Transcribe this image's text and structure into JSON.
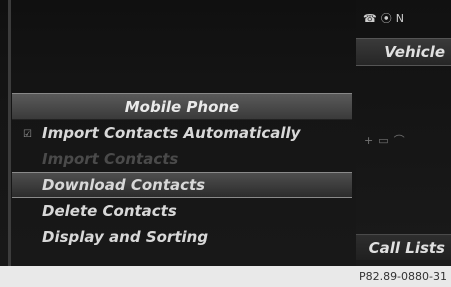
{
  "status_bar": {
    "signal_label": "N"
  },
  "right_panel": {
    "vehicle_label": "Vehicle",
    "call_lists_label": "Call Lists"
  },
  "menu": {
    "title": "Mobile Phone",
    "items": [
      {
        "label": "Import Contacts Automatically",
        "state": "checked"
      },
      {
        "label": "Import Contacts",
        "state": "disabled"
      },
      {
        "label": "Download Contacts",
        "state": "selected"
      },
      {
        "label": "Delete Contacts",
        "state": "normal"
      },
      {
        "label": "Display and Sorting",
        "state": "normal"
      }
    ]
  },
  "caption": {
    "figure_id": "P82.89-0880-31"
  },
  "colors": {
    "screen_bg": "#151515",
    "highlight": "#4e4e4e",
    "caption_bg": "#e9e9e9"
  }
}
